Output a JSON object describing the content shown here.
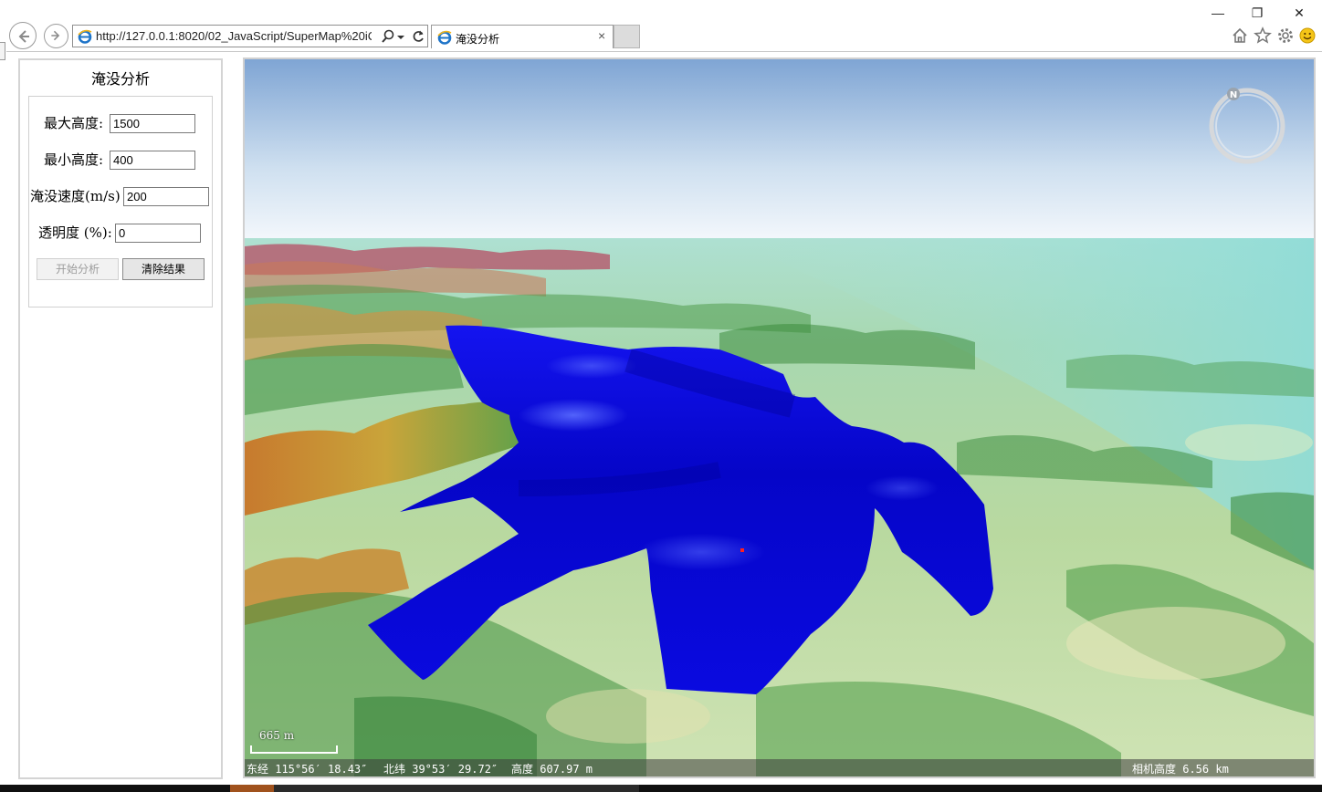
{
  "browser": {
    "window_buttons": {
      "minimize": "—",
      "restore": "❐",
      "close": "✕"
    },
    "address_url": "http://127.0.0.1:8020/02_JavaScript/SuperMap%20iCli",
    "tab_title": "淹没分析",
    "tab_close": "×",
    "icons": [
      "back-icon",
      "forward-icon",
      "search-icon",
      "dropdown-icon",
      "refresh-icon",
      "home-icon",
      "favorites-icon",
      "settings-icon",
      "smiley-icon"
    ],
    "accent_color": "#1e74c8"
  },
  "panel": {
    "title": "淹没分析",
    "fields": {
      "max_height_label": "最大高度:",
      "max_height_value": "1500",
      "min_height_label": "最小高度:",
      "min_height_value": "400",
      "speed_label": "淹没速度(m/s)",
      "speed_value": "200",
      "opacity_label": "透明度 (%):",
      "opacity_value": "0"
    },
    "buttons": {
      "start": "开始分析",
      "clear": "清除结果"
    }
  },
  "scene": {
    "compass_letter": "N",
    "scale_text": "665 m",
    "status": {
      "lon": "东经 115°56′ 18.43″",
      "lat": "北纬 39°53′ 29.72″",
      "height": "高度 607.97 m",
      "camera": "相机高度 6.56 km"
    },
    "flood_color": "#0a0ad2",
    "sky_color": "#7fa5d4"
  }
}
